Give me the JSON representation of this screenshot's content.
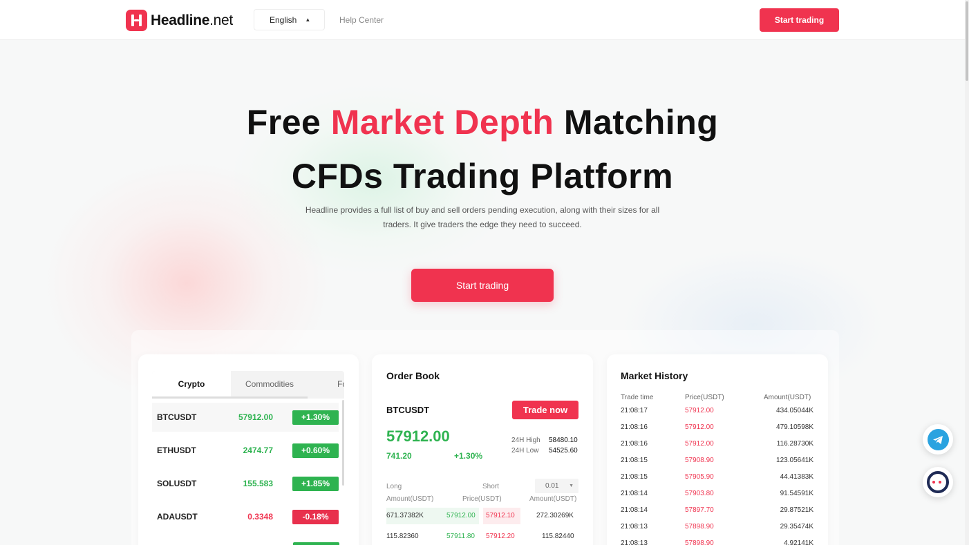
{
  "header": {
    "brand_name": "Headline",
    "brand_tld": ".net",
    "language": "English",
    "help_center": "Help Center",
    "start_trading": "Start trading"
  },
  "hero": {
    "line1_a": "Free ",
    "line1_accent": "Market Depth",
    "line1_b": " Matching",
    "line2": "CFDs Trading Platform",
    "subtitle_1": "Headline provides a full list of buy and sell orders pending execution, along with their sizes for all",
    "subtitle_2": "traders. It give traders the edge they need to succeed.",
    "cta": "Start trading"
  },
  "markets": {
    "tabs": [
      "Crypto",
      "Commodities",
      "Fo"
    ],
    "rows": [
      {
        "symbol": "BTCUSDT",
        "price": "57912.00",
        "change": "+1.30%",
        "dir": "up"
      },
      {
        "symbol": "ETHUSDT",
        "price": "2474.77",
        "change": "+0.60%",
        "dir": "up"
      },
      {
        "symbol": "SOLUSDT",
        "price": "155.583",
        "change": "+1.85%",
        "dir": "up"
      },
      {
        "symbol": "ADAUSDT",
        "price": "0.3348",
        "change": "-0.18%",
        "dir": "down"
      }
    ]
  },
  "order_book": {
    "title": "Order Book",
    "symbol": "BTCUSDT",
    "trade_now": "Trade now",
    "last_price": "57912.00",
    "change_abs": "741.20",
    "change_pct": "+1.30%",
    "high_label": "24H High",
    "high_value": "58480.10",
    "low_label": "24H Low",
    "low_value": "54525.60",
    "long_label": "Long",
    "short_label": "Short",
    "precision": "0.01",
    "col_amount_left": "Amount(USDT)",
    "col_price": "Price(USDT)",
    "col_amount_right": "Amount(USDT)",
    "rows": [
      {
        "long_amount": "671.37382K",
        "bid": "57912.00",
        "ask": "57912.10",
        "short_amount": "272.30269K"
      },
      {
        "long_amount": "115.82360",
        "bid": "57911.80",
        "ask": "57912.20",
        "short_amount": "115.82440"
      }
    ]
  },
  "market_history": {
    "title": "Market History",
    "col_time": "Trade time",
    "col_price": "Price(USDT)",
    "col_amount": "Amount(USDT)",
    "rows": [
      {
        "time": "21:08:17",
        "price": "57912.00",
        "amount": "434.05044K"
      },
      {
        "time": "21:08:16",
        "price": "57912.00",
        "amount": "479.10598K"
      },
      {
        "time": "21:08:16",
        "price": "57912.00",
        "amount": "116.28730K"
      },
      {
        "time": "21:08:15",
        "price": "57908.90",
        "amount": "123.05641K"
      },
      {
        "time": "21:08:15",
        "price": "57905.90",
        "amount": "44.41383K"
      },
      {
        "time": "21:08:14",
        "price": "57903.80",
        "amount": "91.54591K"
      },
      {
        "time": "21:08:14",
        "price": "57897.70",
        "amount": "29.87521K"
      },
      {
        "time": "21:08:13",
        "price": "57898.90",
        "amount": "29.35474K"
      },
      {
        "time": "21:08:13",
        "price": "57898.90",
        "amount": "4.92141K"
      }
    ]
  },
  "floating": {
    "telegram_icon": "telegram-icon",
    "support_icon": "customer-service-icon"
  },
  "colors": {
    "brand": "#f0334f",
    "up": "#2eb350",
    "down": "#e8304d"
  }
}
